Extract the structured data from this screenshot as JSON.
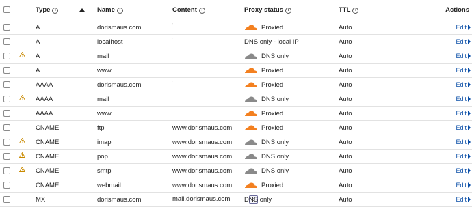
{
  "header": {
    "type": "Type",
    "name": "Name",
    "content": "Content",
    "proxy_status": "Proxy status",
    "ttl": "TTL",
    "actions": "Actions"
  },
  "info_glyph": "i",
  "edit_label": "Edit",
  "records": [
    {
      "type": "A",
      "name": "dorismaus.com",
      "content": "",
      "priority": "",
      "proxy": "Proxied",
      "ttl": "Auto",
      "warning": false,
      "cloud": "orange",
      "dot": true
    },
    {
      "type": "A",
      "name": "localhost",
      "content": "",
      "priority": "",
      "proxy": "DNS only - local IP",
      "ttl": "Auto",
      "warning": false,
      "cloud": "none",
      "dot": true
    },
    {
      "type": "A",
      "name": "mail",
      "content": "",
      "priority": "",
      "proxy": "DNS only",
      "ttl": "Auto",
      "warning": true,
      "cloud": "gray",
      "dot": false
    },
    {
      "type": "A",
      "name": "www",
      "content": "",
      "priority": "",
      "proxy": "Proxied",
      "ttl": "Auto",
      "warning": false,
      "cloud": "orange",
      "dot": false
    },
    {
      "type": "AAAA",
      "name": "dorismaus.com",
      "content": "",
      "priority": "",
      "proxy": "Proxied",
      "ttl": "Auto",
      "warning": false,
      "cloud": "orange",
      "dot": true
    },
    {
      "type": "AAAA",
      "name": "mail",
      "content": "",
      "priority": "",
      "proxy": "DNS only",
      "ttl": "Auto",
      "warning": true,
      "cloud": "gray",
      "dot": false
    },
    {
      "type": "AAAA",
      "name": "www",
      "content": "",
      "priority": "",
      "proxy": "Proxied",
      "ttl": "Auto",
      "warning": false,
      "cloud": "orange",
      "dot": false
    },
    {
      "type": "CNAME",
      "name": "ftp",
      "content": "www.dorismaus.com",
      "priority": "",
      "proxy": "Proxied",
      "ttl": "Auto",
      "warning": false,
      "cloud": "orange",
      "dot": false
    },
    {
      "type": "CNAME",
      "name": "imap",
      "content": "www.dorismaus.com",
      "priority": "",
      "proxy": "DNS only",
      "ttl": "Auto",
      "warning": true,
      "cloud": "gray",
      "dot": false
    },
    {
      "type": "CNAME",
      "name": "pop",
      "content": "www.dorismaus.com",
      "priority": "",
      "proxy": "DNS only",
      "ttl": "Auto",
      "warning": true,
      "cloud": "gray",
      "dot": false
    },
    {
      "type": "CNAME",
      "name": "smtp",
      "content": "www.dorismaus.com",
      "priority": "",
      "proxy": "DNS only",
      "ttl": "Auto",
      "warning": true,
      "cloud": "gray",
      "dot": false
    },
    {
      "type": "CNAME",
      "name": "webmail",
      "content": "www.dorismaus.com",
      "priority": "",
      "proxy": "Proxied",
      "ttl": "Auto",
      "warning": false,
      "cloud": "orange",
      "dot": false
    },
    {
      "type": "MX",
      "name": "dorismaus.com",
      "content": "mail.dorismaus.com",
      "priority": "3",
      "proxy": "DNS only",
      "ttl": "Auto",
      "warning": false,
      "cloud": "none",
      "dot": false
    }
  ],
  "colors": {
    "proxied_cloud": "#f38020",
    "dns_only_cloud": "#8a8a8a",
    "warning": "#c98a00",
    "link": "#0b4fa8"
  },
  "icons": {
    "select_all": "checkbox-icon",
    "warning": "warning-triangle-icon",
    "proxied": "orange-cloud-icon",
    "dns_only": "gray-cloud-icon",
    "sort": "sort-ascending-icon",
    "edit_caret": "caret-right-icon"
  }
}
